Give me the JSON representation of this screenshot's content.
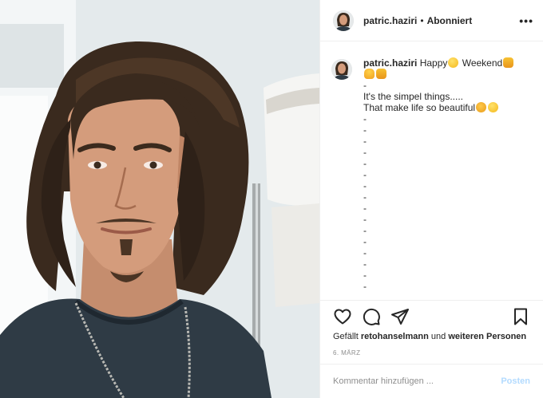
{
  "post": {
    "photo_alt": "Selfie of a man with long brown hair and a goatee, wearing a dark t-shirt and a chain necklace",
    "header": {
      "username": "patric.haziri",
      "separator": "•",
      "follow_status": "Abonniert",
      "more_icon": "more-horizontal-icon",
      "more_label": "•••"
    },
    "caption": {
      "username": "patric.haziri",
      "lines": [
        {
          "text": "Happy",
          "emoji_after": [
            "grinning-emoji"
          ]
        },
        {
          "text": " Weekend",
          "emoji_after": [
            "raising-hands-emoji"
          ]
        },
        {
          "text": "",
          "emoji_after": [
            "person-bowing-emoji",
            "raising-hands-emoji"
          ]
        }
      ],
      "dash_lines_before": 1,
      "line_a": "It's the simpel things.....",
      "line_b": "That make life so beautiful",
      "line_b_emojis": [
        "clapping-emoji",
        "kiss-emoji"
      ],
      "dash": "-"
    },
    "actions": {
      "like_icon": "heart-icon",
      "comment_icon": "comment-icon",
      "share_icon": "paper-plane-icon",
      "save_icon": "bookmark-icon"
    },
    "likes": {
      "prefix": "Gefällt",
      "first_liker": "retohanselmann",
      "middle": "und",
      "others": "weiteren Personen"
    },
    "date": "6. MÄRZ",
    "comment_box": {
      "placeholder": "Kommentar hinzufügen ...",
      "post_label": "Posten"
    },
    "colors": {
      "text": "#262626",
      "secondary": "#8e8e8e",
      "border": "#efefef",
      "post_button_disabled": "#b3dbff"
    }
  }
}
